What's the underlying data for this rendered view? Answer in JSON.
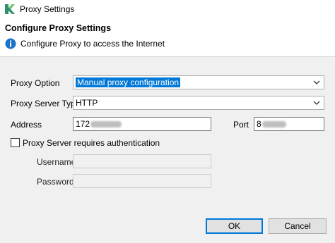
{
  "window": {
    "title": "Proxy Settings",
    "header_title": "Configure Proxy Settings",
    "header_message": "Configure Proxy to access the Internet"
  },
  "form": {
    "proxy_option_label": "Proxy Option",
    "proxy_option_value": "Manual proxy configuration",
    "server_type_label": "Proxy Server Type",
    "server_type_value": "HTTP",
    "address_label": "Address",
    "address_value": "172",
    "port_label": "Port",
    "port_value": "8",
    "auth_label": "Proxy Server requires authentication",
    "auth_checked": false,
    "username_label": "Username",
    "username_value": "",
    "password_label": "Password",
    "password_value": ""
  },
  "buttons": {
    "ok_label": "OK",
    "cancel_label": "Cancel"
  },
  "colors": {
    "accent": "#0078d7",
    "info_icon": "#1a73c9",
    "app_icon": "#2f8f6b"
  },
  "icons": {
    "app": "app-logo-icon",
    "info": "info-icon",
    "dropdown": "chevron-down-icon"
  }
}
